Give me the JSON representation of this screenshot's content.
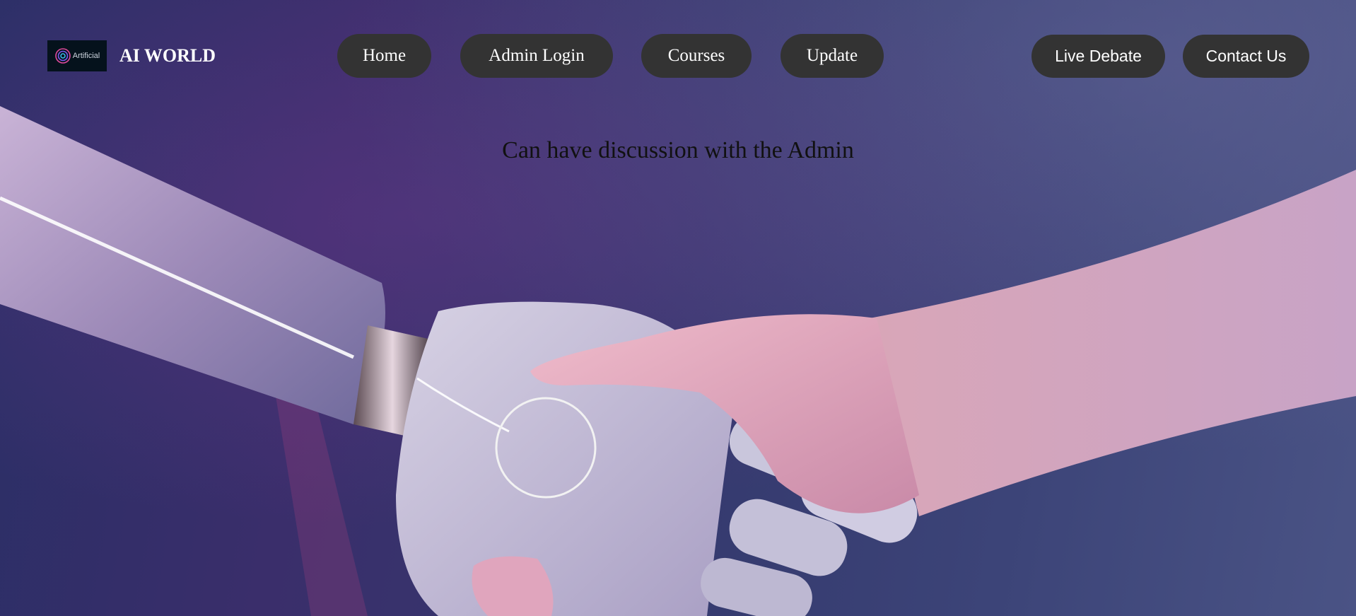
{
  "header": {
    "brand_logo_text": "Artificial",
    "brand_name": "AI WORLD"
  },
  "nav": {
    "home": "Home",
    "admin_login": "Admin Login",
    "courses": "Courses",
    "update": "Update",
    "live_debate": "Live Debate",
    "contact_us": "Contact Us"
  },
  "hero": {
    "subtitle": "Can have discussion with the Admin",
    "image_description_icon": "robot-human-handshake-image"
  },
  "colors": {
    "nav_button_bg": "#333333",
    "nav_button_text": "#ffffff",
    "subtitle_text": "#111111"
  }
}
